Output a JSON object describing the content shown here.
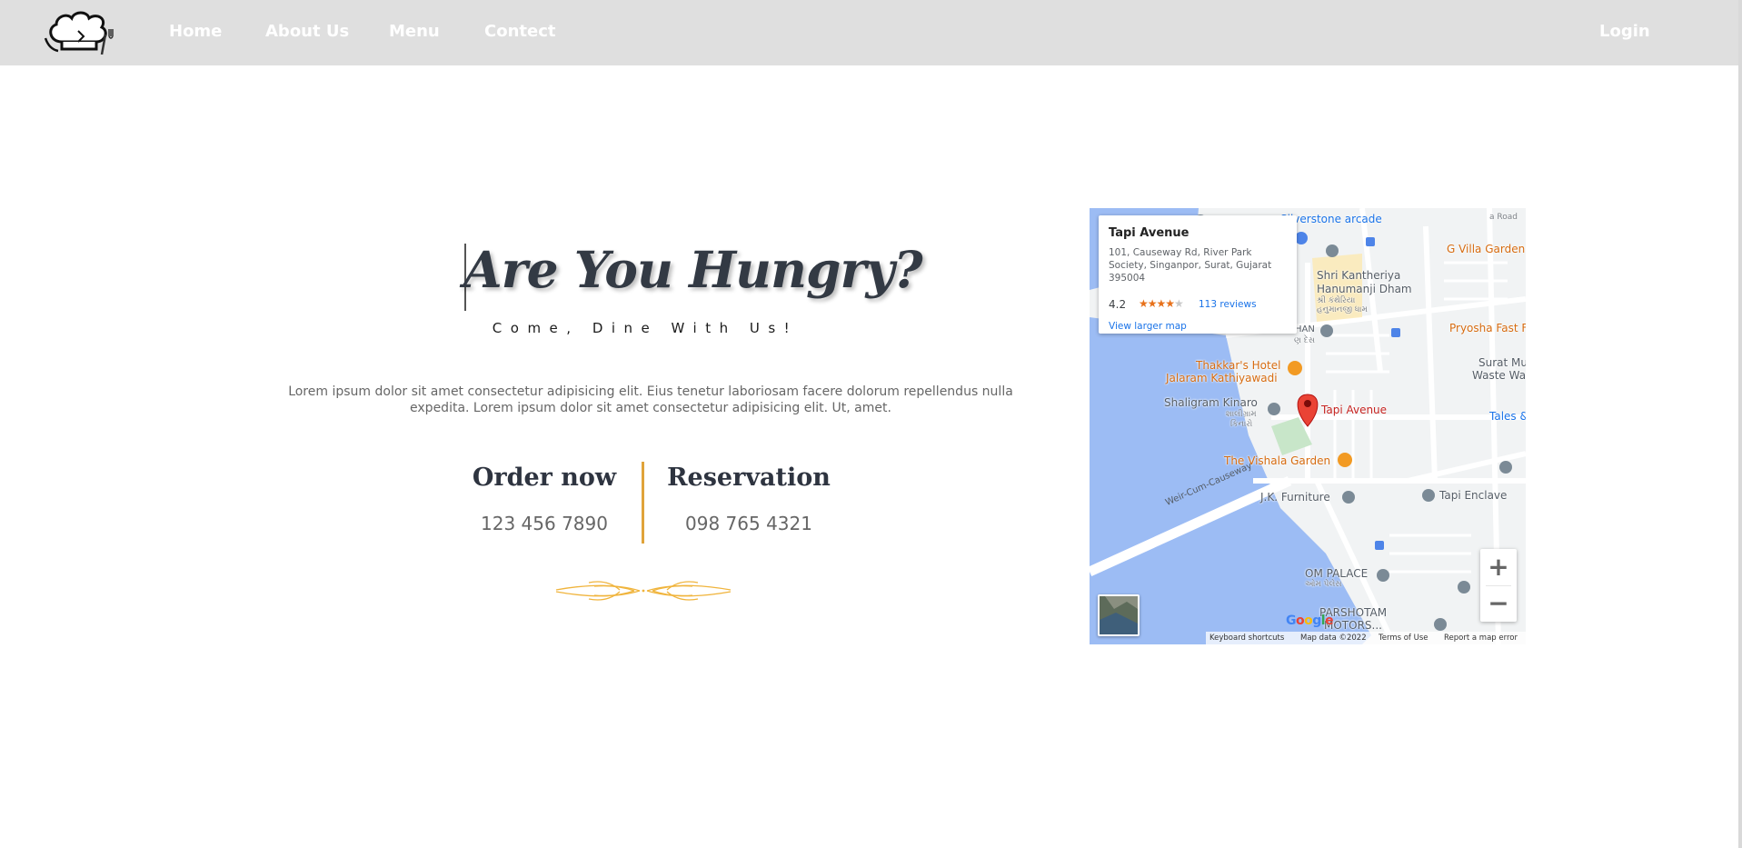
{
  "nav": {
    "logo_icon": "chef-hat-icon",
    "links": [
      "Home",
      "About Us",
      "Menu",
      "Contect"
    ],
    "login": "Login",
    "bg_color": "#dfdfdf"
  },
  "hero": {
    "title": "Are You Hungry?",
    "subtitle": "Come, Dine With Us!",
    "description": "Lorem ipsum dolor sit amet consectetur adipisicing elit. Eius tenetur laboriosam facere dolorum repellendus nulla expedita. Lorem ipsum dolor sit amet consectetur adipisicing elit. Ut, amet."
  },
  "contacts": [
    {
      "heading": "Order now",
      "phone": "123 456 7890"
    },
    {
      "heading": "Reservation",
      "phone": "098 765 4321"
    }
  ],
  "accent_color": "#e0a33a",
  "map": {
    "place_name": "Tapi Avenue",
    "address": "101, Causeway Rd, River Park Society, Singanpor, Surat, Gujarat 395004",
    "rating": "4.2",
    "rating_stars": 4.2,
    "reviews": "113 reviews",
    "larger_map": "View larger map",
    "labels": {
      "silverstone": "Silverstone arcade",
      "gvilla": "G Villa Garden",
      "kantheriya": "Shri Kantheriya",
      "hanumanji": "Hanumanji Dham",
      "kantheriya_gu": "શ્રી કંથેરિયા",
      "hanumanji_gu": "હનુમાનજી ધામ",
      "pryosha": "Pryosha Fast Food",
      "thakkar": "Thakkar's Hotel",
      "jalaram": "Jalaram Kathiyawadi",
      "surat_mu": "Surat Mu",
      "waste_water": "Waste Water tr",
      "shaligram": "Shaligram Kinaro",
      "shaligram_gu1": "શાલીગ્રામ",
      "shaligram_gu2": "કિનારો",
      "tapi_avenue": "Tapi Avenue",
      "tales": "Tales & Stor",
      "vishala": "The Vishala Garden",
      "jk": "J.K. Furniture",
      "tapi_enclave": "Tapi Enclave",
      "causeway": "Weir-Cum-Causeway",
      "om_palace": "OM PALACE",
      "om_palace_gu": "ઓમ પેલેસ",
      "parshotam": "PARSHOTAM",
      "motors": "MOTORS...",
      "han": "HAN",
      "road": "a Road",
      "pin_dash": "ણ દેસ"
    },
    "zoom_in": "+",
    "zoom_out": "−",
    "google": [
      "G",
      "o",
      "o",
      "g",
      "l",
      "e"
    ],
    "attribution": {
      "shortcuts": "Keyboard shortcuts",
      "data": "Map data ©2022",
      "terms": "Terms of Use",
      "report": "Report a map error"
    }
  }
}
